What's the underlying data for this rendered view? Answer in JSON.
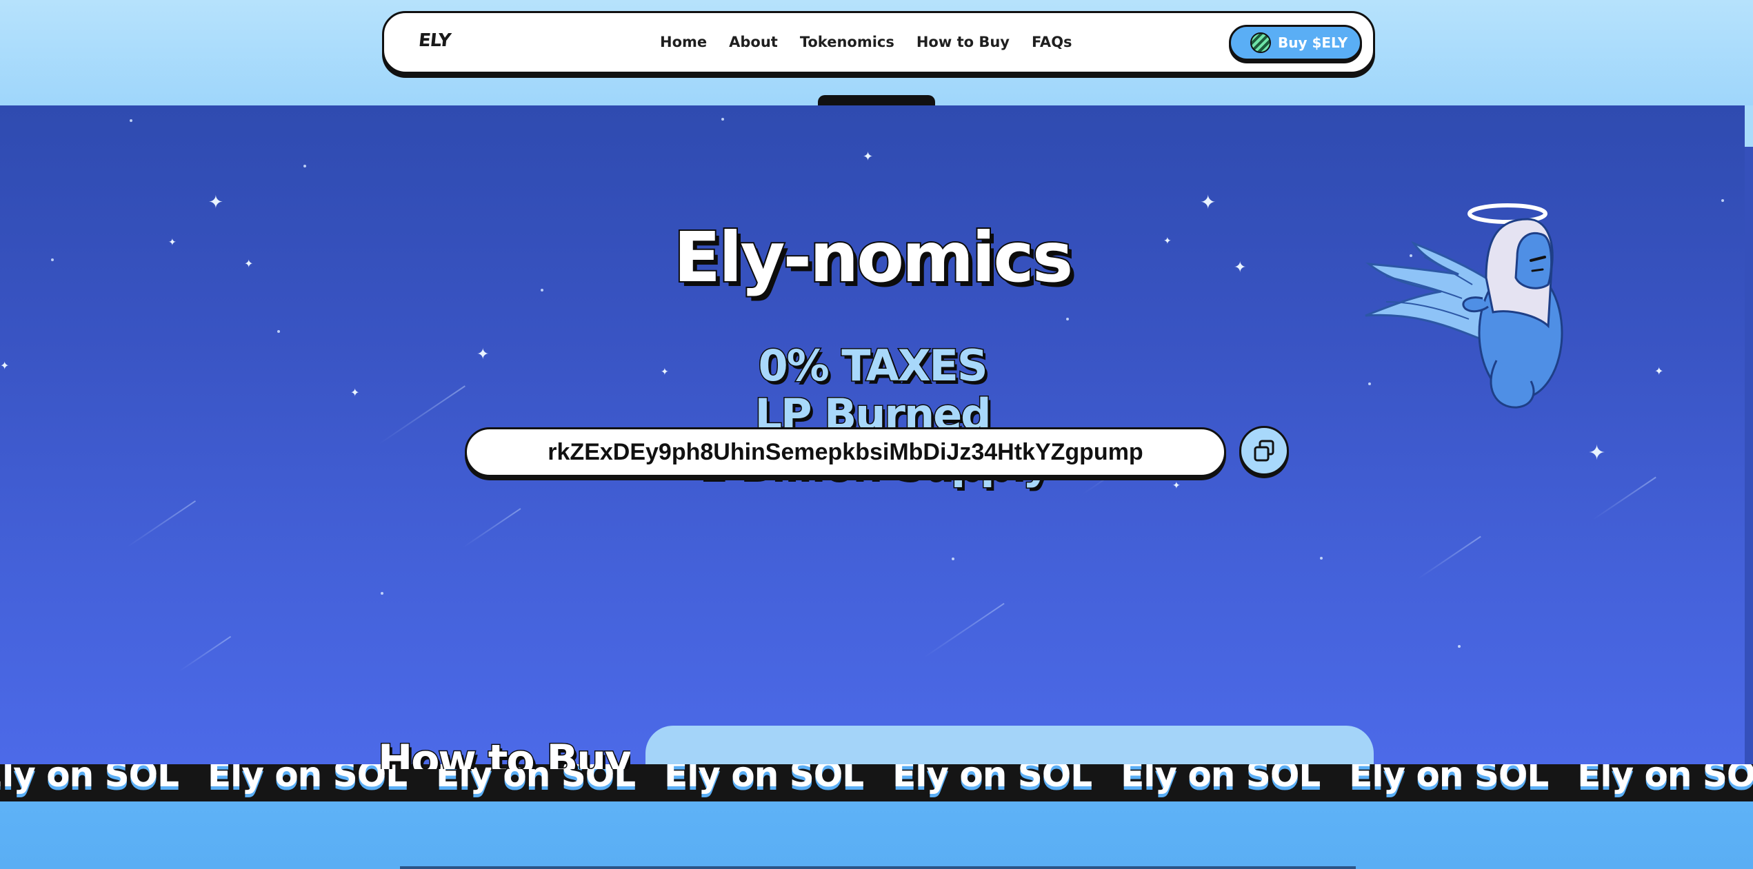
{
  "nav": {
    "logo": "ELY",
    "links": [
      "Home",
      "About",
      "Tokenomics",
      "How to Buy",
      "FAQs"
    ],
    "buy_button": "Buy $ELY"
  },
  "tokenomics": {
    "title": "Ely-nomics",
    "features": [
      "0% TAXES",
      "LP Burned",
      "1 Billion Supply"
    ],
    "contract_address": "rkZExDEy9ph8UhinSemepkbsiMbDiJz34HtkYZgpump"
  },
  "marquee": {
    "text": "Ely on SOL"
  },
  "how_to_buy": {
    "heading": "How to Buy"
  },
  "colors": {
    "sky_light": "#a9dcfb",
    "panel_blue": "#3954c3",
    "accent_blue": "#5aaef5",
    "feature_text": "#a8d8fb",
    "marquee_bg": "#151515"
  }
}
